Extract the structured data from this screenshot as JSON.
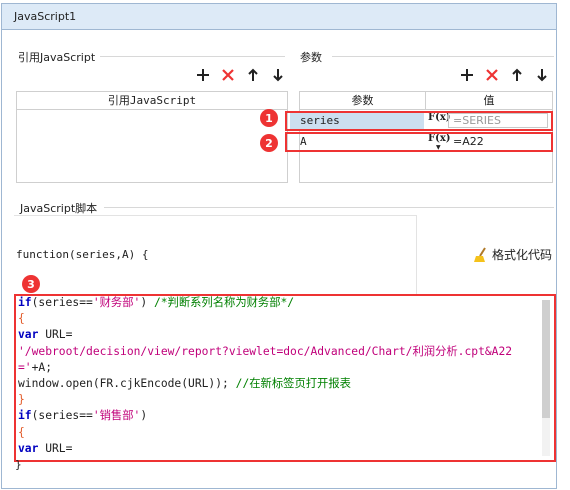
{
  "tab": {
    "title": "JavaScript1"
  },
  "left": {
    "section_label": "引用JavaScript",
    "column_header": "引用JavaScript"
  },
  "right": {
    "section_label": "参数",
    "col_param": "参数",
    "col_value": "值",
    "rows": [
      {
        "name": "series",
        "fx": "F(x)",
        "value": "=SERIES"
      },
      {
        "name": "A",
        "fx": "F(x)",
        "value": "=A22"
      }
    ]
  },
  "script": {
    "section_label": "JavaScript脚本",
    "signature": "function(series,A) {",
    "format_button": "格式化代码",
    "closing": "}"
  },
  "badges": [
    "1",
    "2",
    "3"
  ],
  "colors": {
    "accent": "#e33333",
    "tab_bg": "#ddeaf7",
    "keyword": "#0000c0",
    "string": "#c0007a",
    "comment": "#008000"
  }
}
